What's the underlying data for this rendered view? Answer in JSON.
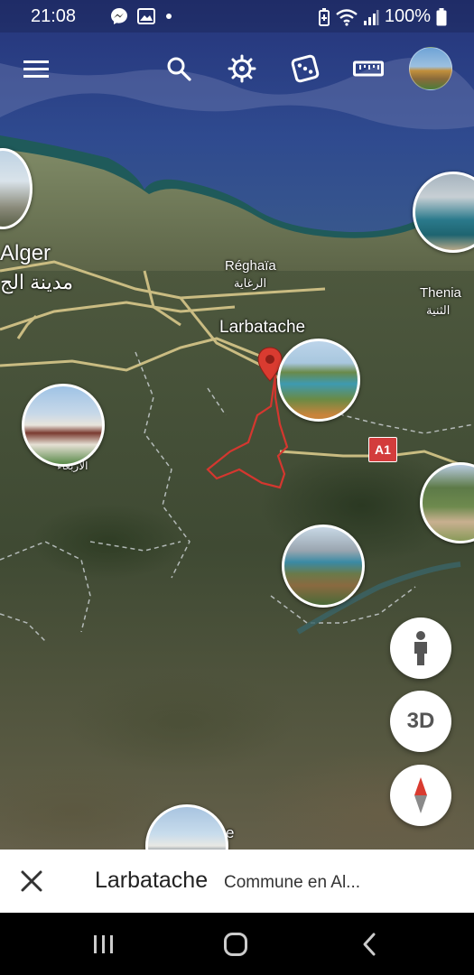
{
  "status_bar": {
    "time": "21:08",
    "battery": "100%",
    "icons": [
      "messenger-icon",
      "gallery-icon",
      "dot-icon",
      "battery-saver-icon",
      "wifi-icon",
      "signal-icon",
      "battery-icon"
    ]
  },
  "toolbar": {
    "icons": [
      "menu-icon",
      "search-icon",
      "voyager-icon",
      "dice-icon",
      "ruler-icon",
      "avatar"
    ]
  },
  "map": {
    "labels": {
      "alger": "Alger",
      "alger_ar": "مدينة الج",
      "reghaia": "Réghaïa",
      "reghaia_ar": "الرغاية",
      "thenia": "Thenia",
      "thenia_ar": "الثنية",
      "larbatache": "Larbatache",
      "larbaa_ar": "الأربعاء",
      "road_shield": "A1",
      "partial_e": "e"
    }
  },
  "controls": {
    "three_d_label": "3D",
    "icons": [
      "pegman-icon",
      "compass-icon"
    ]
  },
  "bottom_sheet": {
    "title": "Larbatache",
    "subtitle": "Commune en Al..."
  },
  "nav_bar": {
    "icons": [
      "recents-icon",
      "home-icon",
      "back-icon"
    ]
  },
  "colors": {
    "accent_red": "#d33c3c",
    "sheet_bg": "#ffffff",
    "navbar_bg": "#000000"
  }
}
